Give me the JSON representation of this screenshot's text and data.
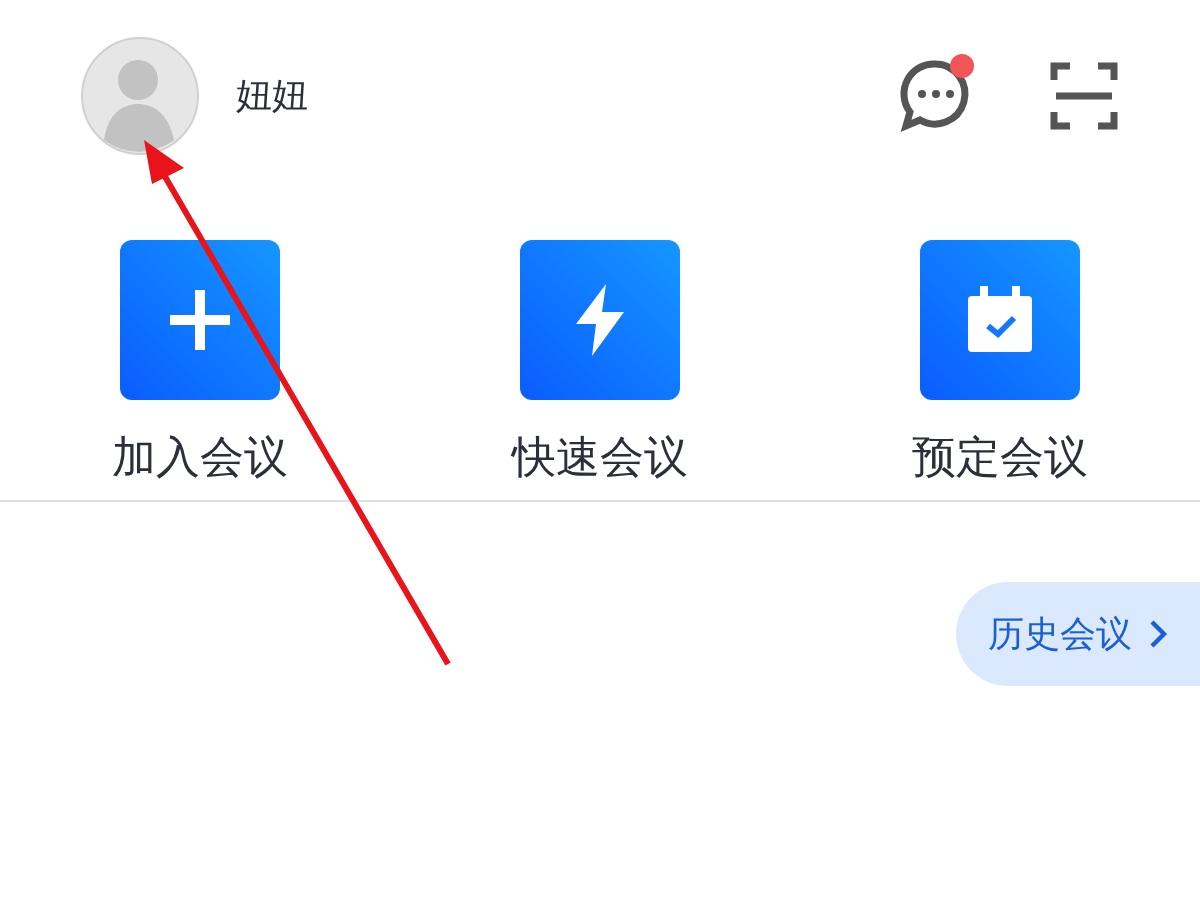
{
  "user": {
    "name": "妞妞"
  },
  "header": {
    "messages_unread": true
  },
  "actions": [
    {
      "kind": "join",
      "label": "加入会议"
    },
    {
      "kind": "quick",
      "label": "快速会议"
    },
    {
      "kind": "schedule",
      "label": "预定会议"
    }
  ],
  "history_button": {
    "label": "历史会议"
  }
}
